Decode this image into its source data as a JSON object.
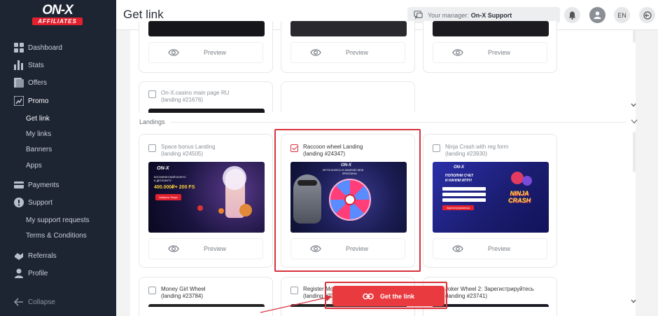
{
  "brand": {
    "logo_main": "ON-X",
    "logo_sub": "AFFILIATES"
  },
  "sidebar": {
    "items": [
      {
        "label": "Dashboard",
        "icon": "dashboard-icon"
      },
      {
        "label": "Stats",
        "icon": "stats-icon"
      },
      {
        "label": "Offers",
        "icon": "offers-icon"
      },
      {
        "label": "Promo",
        "icon": "promo-icon"
      },
      {
        "label": "Payments",
        "icon": "payments-icon"
      },
      {
        "label": "Support",
        "icon": "support-icon"
      },
      {
        "label": "Referrals",
        "icon": "referrals-icon"
      },
      {
        "label": "Profile",
        "icon": "profile-icon"
      }
    ],
    "promo_sub": [
      "Get link",
      "My links",
      "Banners",
      "Apps"
    ],
    "support_sub": [
      "My support requests",
      "Terms & Conditions"
    ],
    "active_sub": "Get link",
    "collapse_label": "Collapse"
  },
  "header": {
    "title": "Get link",
    "manager_prefix": "Your manager:",
    "manager_name": "On-X Support",
    "lang": "EN"
  },
  "preview_label": "Preview",
  "top_card": {
    "name": "On-X.casino main page RU",
    "id": "(landing #21676)"
  },
  "section": {
    "label": "Landings"
  },
  "landings": [
    {
      "name": "Space bonus Landing",
      "id": "(landing #24505)",
      "checked": false
    },
    {
      "name": "Raccoon wheel Landing",
      "id": "(landing #24347)",
      "checked": true
    },
    {
      "name": "Ninja Crash with reg form",
      "id": "(landing #23930)",
      "checked": false
    },
    {
      "name": "Money Girl Wheel",
      "id": "(landing #23784)",
      "checked": false
    },
    {
      "name": "Register Mo",
      "id": "(landing #237",
      "checked": false
    },
    {
      "name": "Joker Wheel 2: Зарегистрируйтесь",
      "id": "(landing #23741)",
      "checked": false
    }
  ],
  "thumbs": {
    "space": {
      "logo": "ON-X",
      "line1": "КОСМИЧЕСКИЙ БОНУС",
      "line2": "К ДЕПОЗИТУ",
      "offer": "400.000₽+ 200 FS",
      "cta": "Забрать бонус"
    },
    "raccoon": {
      "logo": "ON-X",
      "line1": "КРУТИ КОЛЕСО И ЗАБИРАЙ СВОИ",
      "line2": "ФРИСПИНЫ"
    },
    "ninja": {
      "logo": "ON-X",
      "line1": "ПОПОЛНИ СЧЕТ",
      "line2": "И НАЧНИ ИГРУ!",
      "game": "NINJA CRASH",
      "cta": "Зарегистрироваться"
    }
  },
  "get_link_button": "Get the link",
  "colors": {
    "accent": "#e83a3f",
    "sidebar": "#1d2533",
    "highlight": "#d8323c"
  }
}
